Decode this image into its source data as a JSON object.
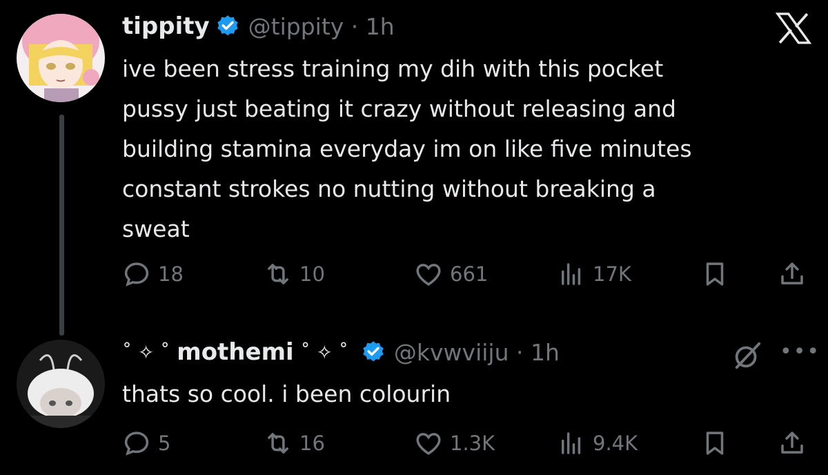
{
  "tweet1": {
    "display_name": "tippity",
    "handle_time": "@tippity · 1h",
    "text": "ive been stress training my dih with this pocket\npussy just beating it crazy without releasing and\nbuilding stamina everyday im on like five minutes\nconstant strokes no nutting without breaking a\nsweat",
    "replies": "18",
    "retweets": "10",
    "likes": "661",
    "views": "17K"
  },
  "tweet2": {
    "sparkle_left": "˚ ✧ ˚",
    "display_name": "mothemi",
    "sparkle_right": "˚ ✧ ˚",
    "handle_time": "@kvwviiju · 1h",
    "text": "thats so cool. i been colourin",
    "replies": "5",
    "retweets": "16",
    "likes": "1.3K",
    "views": "9.4K"
  },
  "icons": {
    "brand": "x-logo-icon",
    "verified": "verified-badge-icon",
    "more": "more-icon",
    "grok": "grok-icon"
  },
  "more_label": "•••",
  "colors": {
    "background": "#000000",
    "text": "#e7e9ea",
    "secondary": "#71767b",
    "verified_blue": "#1d9bf0"
  }
}
